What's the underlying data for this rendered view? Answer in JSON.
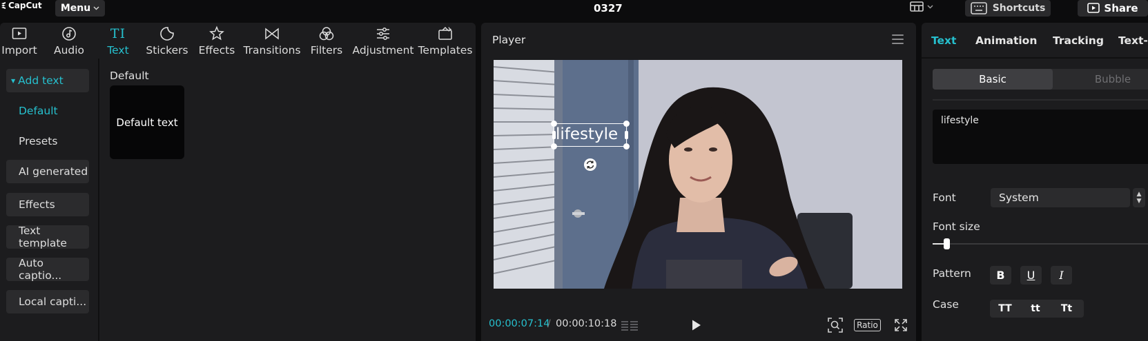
{
  "app": {
    "logo_text": "CapCut",
    "menu_label": "Menu",
    "project_title": "0327",
    "shortcuts_label": "Shortcuts",
    "share_label": "Share"
  },
  "tool_tabs": [
    {
      "label": "Import",
      "icon": "import-icon"
    },
    {
      "label": "Audio",
      "icon": "audio-icon"
    },
    {
      "label": "Text",
      "icon": "text-icon",
      "glyph": "TI",
      "active": true
    },
    {
      "label": "Stickers",
      "icon": "sticker-icon"
    },
    {
      "label": "Effects",
      "icon": "effects-icon"
    },
    {
      "label": "Transitions",
      "icon": "transitions-icon"
    },
    {
      "label": "Filters",
      "icon": "filters-icon"
    },
    {
      "label": "Adjustment",
      "icon": "adjustment-icon"
    },
    {
      "label": "Templates",
      "icon": "templates-icon"
    }
  ],
  "side_nav": {
    "add_text": "Add text",
    "items": [
      "Default",
      "Presets",
      "AI generated",
      "Effects",
      "Text template",
      "Auto captio...",
      "Local capti..."
    ]
  },
  "content": {
    "section_title": "Default",
    "card_label": "Default text"
  },
  "player": {
    "title": "Player",
    "overlay_text": "lifestyle",
    "current_time": "00:00:07:14",
    "separator": "/",
    "total_time": "00:00:10:18",
    "ratio_label": "Ratio"
  },
  "inspector": {
    "tabs": [
      "Text",
      "Animation",
      "Tracking",
      "Text-t"
    ],
    "segments": [
      "Basic",
      "Bubble"
    ],
    "text_value": "lifestyle",
    "font_label": "Font",
    "font_value": "System",
    "font_size_label": "Font size",
    "font_size_level": 0.06,
    "pattern_label": "Pattern",
    "pattern_buttons": [
      "B",
      "U",
      "I"
    ],
    "case_label": "Case",
    "case_buttons": [
      "TT",
      "tt",
      "Tt"
    ]
  },
  "colors": {
    "accent": "#26c0ce",
    "panel": "#1c1c1e",
    "background": "#0c0c0d"
  }
}
